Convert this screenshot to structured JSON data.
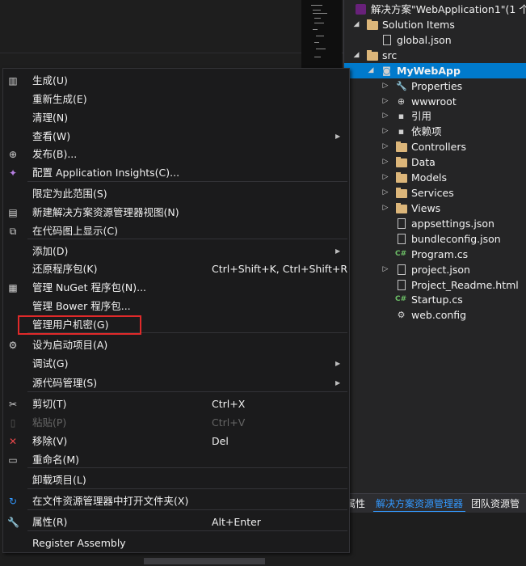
{
  "solution_explorer": {
    "solution_title": "解决方案\"WebApplication1\"(1 个项",
    "items": [
      {
        "label": "Solution Items",
        "icon": "folder-icon",
        "arrow": "expanded"
      },
      {
        "label": "global.json",
        "icon": "json-file-icon",
        "arrow": ""
      },
      {
        "label": "src",
        "icon": "folder-icon",
        "arrow": "expanded"
      },
      {
        "label": "MyWebApp",
        "icon": "web-project-icon",
        "arrow": "expanded",
        "selected": true
      },
      {
        "label": "Properties",
        "icon": "wrench-icon",
        "arrow": "collapsed"
      },
      {
        "label": "wwwroot",
        "icon": "globe-icon",
        "arrow": "collapsed"
      },
      {
        "label": "引用",
        "icon": "references-icon",
        "arrow": "collapsed"
      },
      {
        "label": "依赖项",
        "icon": "dependencies-icon",
        "arrow": "collapsed"
      },
      {
        "label": "Controllers",
        "icon": "folder-icon",
        "arrow": "collapsed"
      },
      {
        "label": "Data",
        "icon": "folder-icon",
        "arrow": "collapsed"
      },
      {
        "label": "Models",
        "icon": "folder-icon",
        "arrow": "collapsed"
      },
      {
        "label": "Services",
        "icon": "folder-icon",
        "arrow": "collapsed"
      },
      {
        "label": "Views",
        "icon": "folder-icon",
        "arrow": "collapsed"
      },
      {
        "label": "appsettings.json",
        "icon": "json-file-icon",
        "arrow": ""
      },
      {
        "label": "bundleconfig.json",
        "icon": "json-file-icon",
        "arrow": ""
      },
      {
        "label": "Program.cs",
        "icon": "cs-file-icon",
        "arrow": ""
      },
      {
        "label": "project.json",
        "icon": "json-file-icon",
        "arrow": "collapsed"
      },
      {
        "label": "Project_Readme.html",
        "icon": "html-file-icon",
        "arrow": ""
      },
      {
        "label": "Startup.cs",
        "icon": "cs-file-icon",
        "arrow": ""
      },
      {
        "label": "web.config",
        "icon": "config-file-icon",
        "arrow": ""
      }
    ],
    "tabs": [
      "属性",
      "解决方案资源管理器",
      "团队资源管"
    ]
  },
  "context_menu": {
    "items": [
      {
        "label": "生成(U)",
        "icon": "build-icon"
      },
      {
        "label": "重新生成(E)"
      },
      {
        "label": "清理(N)"
      },
      {
        "label": "查看(W)",
        "submenu": true
      },
      {
        "label": "发布(B)...",
        "icon": "publish-icon"
      },
      {
        "label": "配置 Application Insights(C)...",
        "icon": "insights-icon"
      },
      {
        "label": "限定为此范围(S)"
      },
      {
        "label": "新建解决方案资源管理器视图(N)",
        "icon": "new-view-icon"
      },
      {
        "label": "在代码图上显示(C)",
        "icon": "code-map-icon"
      },
      {
        "label": "添加(D)",
        "submenu": true
      },
      {
        "label": "还原程序包(K)",
        "shortcut": "Ctrl+Shift+K, Ctrl+Shift+R"
      },
      {
        "label": "管理 NuGet 程序包(N)...",
        "icon": "nuget-icon"
      },
      {
        "label": "管理 Bower 程序包..."
      },
      {
        "label": "管理用户机密(G)",
        "highlighted": true
      },
      {
        "label": "设为启动项目(A)",
        "icon": "gear-icon"
      },
      {
        "label": "调试(G)",
        "submenu": true
      },
      {
        "label": "源代码管理(S)",
        "submenu": true
      },
      {
        "label": "剪切(T)",
        "icon": "scissors-icon",
        "shortcut": "Ctrl+X"
      },
      {
        "label": "粘贴(P)",
        "icon": "paste-icon",
        "shortcut": "Ctrl+V",
        "disabled": true
      },
      {
        "label": "移除(V)",
        "icon": "close-icon",
        "shortcut": "Del"
      },
      {
        "label": "重命名(M)",
        "icon": "rename-icon"
      },
      {
        "label": "卸载项目(L)"
      },
      {
        "label": "在文件资源管理器中打开文件夹(X)",
        "icon": "refresh-icon"
      },
      {
        "label": "属性(R)",
        "icon": "wrench-icon",
        "shortcut": "Alt+Enter"
      },
      {
        "label": "Register Assembly"
      }
    ]
  },
  "colors": {
    "selection": "#007acc",
    "highlight_box": "#e02a2a",
    "active_tab": "#3399ff"
  }
}
